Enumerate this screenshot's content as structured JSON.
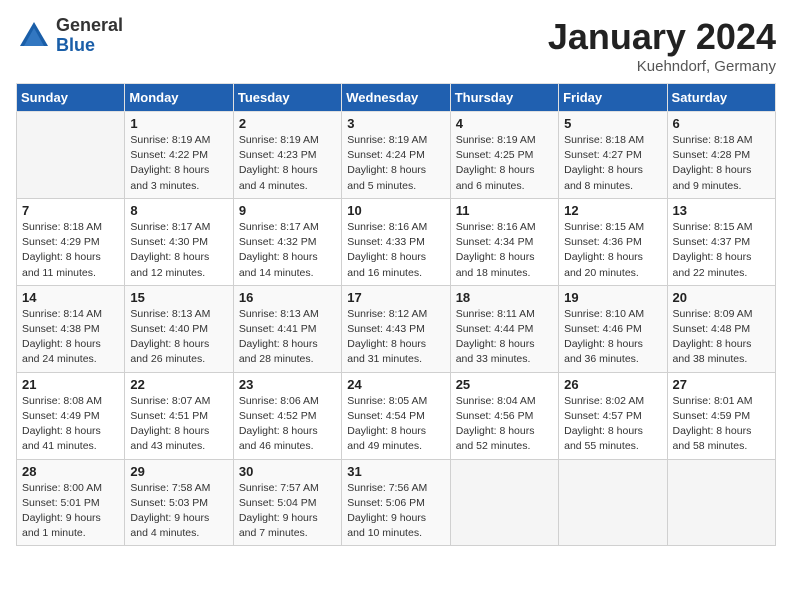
{
  "logo": {
    "general": "General",
    "blue": "Blue"
  },
  "title": "January 2024",
  "location": "Kuehndorf, Germany",
  "days_header": [
    "Sunday",
    "Monday",
    "Tuesday",
    "Wednesday",
    "Thursday",
    "Friday",
    "Saturday"
  ],
  "weeks": [
    [
      {
        "day": "",
        "info": ""
      },
      {
        "day": "1",
        "info": "Sunrise: 8:19 AM\nSunset: 4:22 PM\nDaylight: 8 hours\nand 3 minutes."
      },
      {
        "day": "2",
        "info": "Sunrise: 8:19 AM\nSunset: 4:23 PM\nDaylight: 8 hours\nand 4 minutes."
      },
      {
        "day": "3",
        "info": "Sunrise: 8:19 AM\nSunset: 4:24 PM\nDaylight: 8 hours\nand 5 minutes."
      },
      {
        "day": "4",
        "info": "Sunrise: 8:19 AM\nSunset: 4:25 PM\nDaylight: 8 hours\nand 6 minutes."
      },
      {
        "day": "5",
        "info": "Sunrise: 8:18 AM\nSunset: 4:27 PM\nDaylight: 8 hours\nand 8 minutes."
      },
      {
        "day": "6",
        "info": "Sunrise: 8:18 AM\nSunset: 4:28 PM\nDaylight: 8 hours\nand 9 minutes."
      }
    ],
    [
      {
        "day": "7",
        "info": "Sunrise: 8:18 AM\nSunset: 4:29 PM\nDaylight: 8 hours\nand 11 minutes."
      },
      {
        "day": "8",
        "info": "Sunrise: 8:17 AM\nSunset: 4:30 PM\nDaylight: 8 hours\nand 12 minutes."
      },
      {
        "day": "9",
        "info": "Sunrise: 8:17 AM\nSunset: 4:32 PM\nDaylight: 8 hours\nand 14 minutes."
      },
      {
        "day": "10",
        "info": "Sunrise: 8:16 AM\nSunset: 4:33 PM\nDaylight: 8 hours\nand 16 minutes."
      },
      {
        "day": "11",
        "info": "Sunrise: 8:16 AM\nSunset: 4:34 PM\nDaylight: 8 hours\nand 18 minutes."
      },
      {
        "day": "12",
        "info": "Sunrise: 8:15 AM\nSunset: 4:36 PM\nDaylight: 8 hours\nand 20 minutes."
      },
      {
        "day": "13",
        "info": "Sunrise: 8:15 AM\nSunset: 4:37 PM\nDaylight: 8 hours\nand 22 minutes."
      }
    ],
    [
      {
        "day": "14",
        "info": "Sunrise: 8:14 AM\nSunset: 4:38 PM\nDaylight: 8 hours\nand 24 minutes."
      },
      {
        "day": "15",
        "info": "Sunrise: 8:13 AM\nSunset: 4:40 PM\nDaylight: 8 hours\nand 26 minutes."
      },
      {
        "day": "16",
        "info": "Sunrise: 8:13 AM\nSunset: 4:41 PM\nDaylight: 8 hours\nand 28 minutes."
      },
      {
        "day": "17",
        "info": "Sunrise: 8:12 AM\nSunset: 4:43 PM\nDaylight: 8 hours\nand 31 minutes."
      },
      {
        "day": "18",
        "info": "Sunrise: 8:11 AM\nSunset: 4:44 PM\nDaylight: 8 hours\nand 33 minutes."
      },
      {
        "day": "19",
        "info": "Sunrise: 8:10 AM\nSunset: 4:46 PM\nDaylight: 8 hours\nand 36 minutes."
      },
      {
        "day": "20",
        "info": "Sunrise: 8:09 AM\nSunset: 4:48 PM\nDaylight: 8 hours\nand 38 minutes."
      }
    ],
    [
      {
        "day": "21",
        "info": "Sunrise: 8:08 AM\nSunset: 4:49 PM\nDaylight: 8 hours\nand 41 minutes."
      },
      {
        "day": "22",
        "info": "Sunrise: 8:07 AM\nSunset: 4:51 PM\nDaylight: 8 hours\nand 43 minutes."
      },
      {
        "day": "23",
        "info": "Sunrise: 8:06 AM\nSunset: 4:52 PM\nDaylight: 8 hours\nand 46 minutes."
      },
      {
        "day": "24",
        "info": "Sunrise: 8:05 AM\nSunset: 4:54 PM\nDaylight: 8 hours\nand 49 minutes."
      },
      {
        "day": "25",
        "info": "Sunrise: 8:04 AM\nSunset: 4:56 PM\nDaylight: 8 hours\nand 52 minutes."
      },
      {
        "day": "26",
        "info": "Sunrise: 8:02 AM\nSunset: 4:57 PM\nDaylight: 8 hours\nand 55 minutes."
      },
      {
        "day": "27",
        "info": "Sunrise: 8:01 AM\nSunset: 4:59 PM\nDaylight: 8 hours\nand 58 minutes."
      }
    ],
    [
      {
        "day": "28",
        "info": "Sunrise: 8:00 AM\nSunset: 5:01 PM\nDaylight: 9 hours\nand 1 minute."
      },
      {
        "day": "29",
        "info": "Sunrise: 7:58 AM\nSunset: 5:03 PM\nDaylight: 9 hours\nand 4 minutes."
      },
      {
        "day": "30",
        "info": "Sunrise: 7:57 AM\nSunset: 5:04 PM\nDaylight: 9 hours\nand 7 minutes."
      },
      {
        "day": "31",
        "info": "Sunrise: 7:56 AM\nSunset: 5:06 PM\nDaylight: 9 hours\nand 10 minutes."
      },
      {
        "day": "",
        "info": ""
      },
      {
        "day": "",
        "info": ""
      },
      {
        "day": "",
        "info": ""
      }
    ]
  ]
}
